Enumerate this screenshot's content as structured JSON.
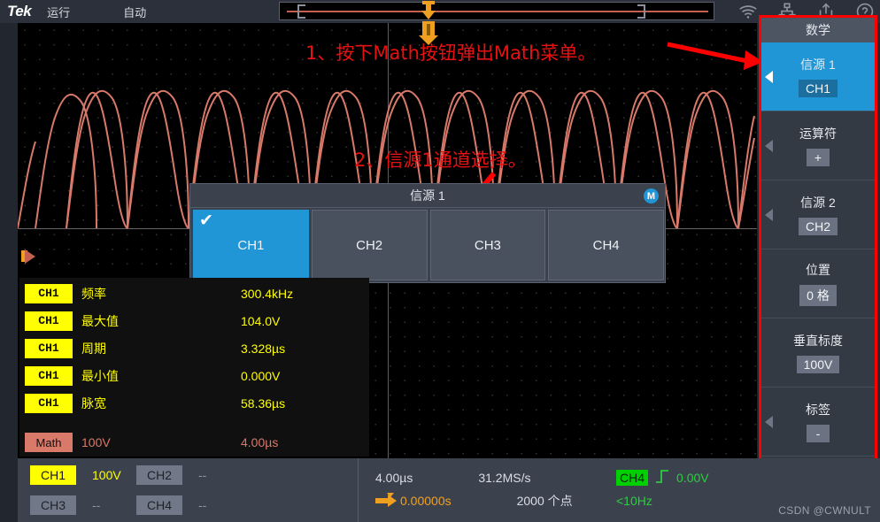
{
  "topbar": {
    "brand": "Tek",
    "run_state": "运行",
    "trigger_mode": "自动",
    "icons": [
      "wifi-icon",
      "network-icon",
      "share-icon",
      "help-icon"
    ]
  },
  "annotations": [
    {
      "id": "anno-1",
      "text": "1、按下Math按钮弹出Math菜单。",
      "color": "#e81111"
    },
    {
      "id": "anno-2",
      "text": "2、信源1通道选择。",
      "color": "#e81111"
    }
  ],
  "source_dialog": {
    "title": "信源 1",
    "badge": "M",
    "options": [
      {
        "label": "CH1",
        "selected": true
      },
      {
        "label": "CH2",
        "selected": false
      },
      {
        "label": "CH3",
        "selected": false
      },
      {
        "label": "CH4",
        "selected": false
      }
    ]
  },
  "measurements": {
    "rows": [
      {
        "channel": "CH1",
        "name": "频率",
        "value": "300.4kHz"
      },
      {
        "channel": "CH1",
        "name": "最大值",
        "value": "104.0V"
      },
      {
        "channel": "CH1",
        "name": "周期",
        "value": "3.328µs"
      },
      {
        "channel": "CH1",
        "name": "最小值",
        "value": "0.000V"
      },
      {
        "channel": "CH1",
        "name": "脉宽",
        "value": "58.36µs"
      }
    ],
    "math_row": {
      "tag": "Math",
      "scale": "100V",
      "timebase": "4.00µs"
    }
  },
  "sidebar": {
    "header": "数学",
    "items": [
      {
        "label": "信源 1",
        "value": "CH1",
        "active": true,
        "has_arrow": true
      },
      {
        "label": "运算符",
        "value": "+",
        "active": false,
        "has_arrow": true
      },
      {
        "label": "信源 2",
        "value": "CH2",
        "active": false,
        "has_arrow": true
      },
      {
        "label": "位置",
        "value": "0 格",
        "active": false,
        "has_arrow": false
      },
      {
        "label": "垂直标度",
        "value": "100V",
        "active": false,
        "has_arrow": false
      },
      {
        "label": "标签",
        "value": "-",
        "active": false,
        "has_arrow": true
      }
    ],
    "highlight_color": "#ff0000"
  },
  "bottombar": {
    "channels": [
      {
        "tag": "CH1",
        "value": "100V",
        "on": true
      },
      {
        "tag": "CH2",
        "value": "--",
        "on": false
      },
      {
        "tag": "CH3",
        "value": "--",
        "on": false
      },
      {
        "tag": "CH4",
        "value": "--",
        "on": false
      }
    ],
    "horizontal": {
      "timebase": "4.00µs",
      "sample_rate": "31.2MS/s",
      "delay": "0.00000s",
      "record_length": "2000 个点"
    },
    "trigger": {
      "source": "CH4",
      "slope": "rising-edge-icon",
      "level": "0.00V",
      "frequency": "<10Hz"
    }
  },
  "watermark": "CSDN @CWNULT",
  "colors": {
    "accent_blue": "#2196d6",
    "ch1_yellow": "#ffff00",
    "math_salmon": "#d8796a",
    "trigger_orange": "#f0a020",
    "trigger_green": "#2ecc40",
    "annotation_red": "#e81111"
  }
}
